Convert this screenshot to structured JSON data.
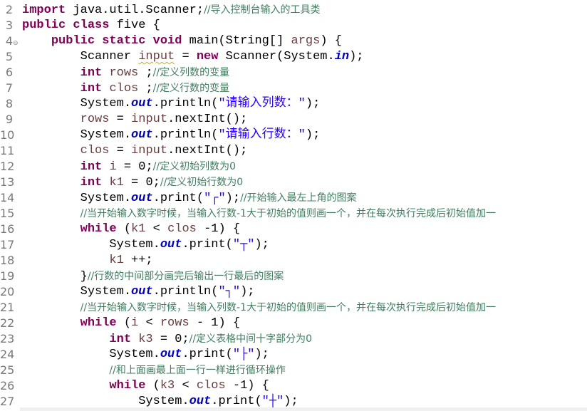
{
  "editor": {
    "language": "java",
    "lines": [
      {
        "n": "2",
        "tokens": [
          [
            "kw",
            "import"
          ],
          [
            "p",
            " java.util.Scanner;"
          ],
          [
            "cm",
            "//导入控制台输入的工具类"
          ]
        ]
      },
      {
        "n": "3",
        "tokens": [
          [
            "kw",
            "public"
          ],
          [
            "p",
            " "
          ],
          [
            "kw",
            "class"
          ],
          [
            "p",
            " five {"
          ]
        ]
      },
      {
        "n": "4",
        "fold": true,
        "tokens": [
          [
            "p",
            "    "
          ],
          [
            "kw",
            "public"
          ],
          [
            "p",
            " "
          ],
          [
            "kw",
            "static"
          ],
          [
            "p",
            " "
          ],
          [
            "kw",
            "void"
          ],
          [
            "p",
            " main(String[] "
          ],
          [
            "var",
            "args"
          ],
          [
            "p",
            ") {"
          ]
        ]
      },
      {
        "n": "5",
        "tokens": [
          [
            "p",
            "        Scanner "
          ],
          [
            "varsq",
            "input"
          ],
          [
            "p",
            " = "
          ],
          [
            "kw",
            "new"
          ],
          [
            "p",
            " Scanner(System."
          ],
          [
            "fld",
            "in"
          ],
          [
            "p",
            ");"
          ]
        ]
      },
      {
        "n": "6",
        "tokens": [
          [
            "p",
            "        "
          ],
          [
            "kw",
            "int"
          ],
          [
            "p",
            " "
          ],
          [
            "var",
            "rows"
          ],
          [
            "p",
            " ;"
          ],
          [
            "cm",
            "//定义列数的变量"
          ]
        ]
      },
      {
        "n": "7",
        "tokens": [
          [
            "p",
            "        "
          ],
          [
            "kw",
            "int"
          ],
          [
            "p",
            " "
          ],
          [
            "var",
            "clos"
          ],
          [
            "p",
            " ;"
          ],
          [
            "cm",
            "//定义行数的变量"
          ]
        ]
      },
      {
        "n": "8",
        "tokens": [
          [
            "p",
            "        System."
          ],
          [
            "fld",
            "out"
          ],
          [
            "p",
            ".println("
          ],
          [
            "str",
            "\"请输入列数：\""
          ],
          [
            "p",
            ");"
          ]
        ]
      },
      {
        "n": "9",
        "tokens": [
          [
            "p",
            "        "
          ],
          [
            "var",
            "rows"
          ],
          [
            "p",
            " = "
          ],
          [
            "var",
            "input"
          ],
          [
            "p",
            ".nextInt();"
          ]
        ]
      },
      {
        "n": "10",
        "tokens": [
          [
            "p",
            "        System."
          ],
          [
            "fld",
            "out"
          ],
          [
            "p",
            ".println("
          ],
          [
            "str",
            "\"请输入行数：\""
          ],
          [
            "p",
            ");"
          ]
        ]
      },
      {
        "n": "11",
        "tokens": [
          [
            "p",
            "        "
          ],
          [
            "var",
            "clos"
          ],
          [
            "p",
            " = "
          ],
          [
            "var",
            "input"
          ],
          [
            "p",
            ".nextInt();"
          ]
        ]
      },
      {
        "n": "12",
        "tokens": [
          [
            "p",
            "        "
          ],
          [
            "kw",
            "int"
          ],
          [
            "p",
            " "
          ],
          [
            "var",
            "i"
          ],
          [
            "p",
            " = 0;"
          ],
          [
            "cm",
            "//定义初始列数为0"
          ]
        ]
      },
      {
        "n": "13",
        "tokens": [
          [
            "p",
            "        "
          ],
          [
            "kw",
            "int"
          ],
          [
            "p",
            " "
          ],
          [
            "var",
            "k1"
          ],
          [
            "p",
            " = 0;"
          ],
          [
            "cm",
            "//定义初始行数为0"
          ]
        ]
      },
      {
        "n": "14",
        "tokens": [
          [
            "p",
            "        System."
          ],
          [
            "fld",
            "out"
          ],
          [
            "p",
            ".print("
          ],
          [
            "str",
            "\"┌\""
          ],
          [
            "p",
            ");"
          ],
          [
            "cm",
            "//开始输入最左上角的图案"
          ]
        ]
      },
      {
        "n": "15",
        "tokens": [
          [
            "p",
            "        "
          ],
          [
            "cm",
            "//当开始输入数字时候，当输入行数-1大于初始的值则画一个，并在每次执行完成后初始值加一"
          ]
        ]
      },
      {
        "n": "16",
        "tokens": [
          [
            "p",
            "        "
          ],
          [
            "kw",
            "while"
          ],
          [
            "p",
            " ("
          ],
          [
            "var",
            "k1"
          ],
          [
            "p",
            " < "
          ],
          [
            "var",
            "clos"
          ],
          [
            "p",
            " -1) {"
          ]
        ]
      },
      {
        "n": "17",
        "tokens": [
          [
            "p",
            "            System."
          ],
          [
            "fld",
            "out"
          ],
          [
            "p",
            ".print("
          ],
          [
            "str",
            "\"┬\""
          ],
          [
            "p",
            ");"
          ]
        ]
      },
      {
        "n": "18",
        "tokens": [
          [
            "p",
            "            "
          ],
          [
            "var",
            "k1"
          ],
          [
            "p",
            " ++;"
          ]
        ]
      },
      {
        "n": "19",
        "tokens": [
          [
            "p",
            "        }"
          ],
          [
            "cm",
            "//行数的中间部分画完后输出一行最后的图案"
          ]
        ]
      },
      {
        "n": "20",
        "tokens": [
          [
            "p",
            "        System."
          ],
          [
            "fld",
            "out"
          ],
          [
            "p",
            ".println("
          ],
          [
            "str",
            "\"┐\""
          ],
          [
            "p",
            ");"
          ]
        ]
      },
      {
        "n": "21",
        "tokens": [
          [
            "p",
            "        "
          ],
          [
            "cm",
            "//当开始输入数字时候，当输入列数-1大于初始的值则画一个，并在每次执行完成后初始值加一"
          ]
        ]
      },
      {
        "n": "22",
        "tokens": [
          [
            "p",
            "        "
          ],
          [
            "kw",
            "while"
          ],
          [
            "p",
            " ("
          ],
          [
            "var",
            "i"
          ],
          [
            "p",
            " < "
          ],
          [
            "var",
            "rows"
          ],
          [
            "p",
            " - 1) {"
          ]
        ]
      },
      {
        "n": "23",
        "tokens": [
          [
            "p",
            "            "
          ],
          [
            "kw",
            "int"
          ],
          [
            "p",
            " "
          ],
          [
            "var",
            "k3"
          ],
          [
            "p",
            " = 0;"
          ],
          [
            "cm",
            "//定义表格中间十字部分为0"
          ]
        ]
      },
      {
        "n": "24",
        "tokens": [
          [
            "p",
            "            System."
          ],
          [
            "fld",
            "out"
          ],
          [
            "p",
            ".print("
          ],
          [
            "str",
            "\"├\""
          ],
          [
            "p",
            ");"
          ]
        ]
      },
      {
        "n": "25",
        "tokens": [
          [
            "p",
            "            "
          ],
          [
            "cm",
            "//和上面画最上面一行一样进行循环操作"
          ]
        ]
      },
      {
        "n": "26",
        "tokens": [
          [
            "p",
            "            "
          ],
          [
            "kw",
            "while"
          ],
          [
            "p",
            " ("
          ],
          [
            "var",
            "k3"
          ],
          [
            "p",
            " < "
          ],
          [
            "var",
            "clos"
          ],
          [
            "p",
            " -1) {"
          ]
        ]
      },
      {
        "n": "27",
        "tokens": [
          [
            "p",
            "                System."
          ],
          [
            "fld",
            "out"
          ],
          [
            "p",
            ".print("
          ],
          [
            "str",
            "\"┼\""
          ],
          [
            "p",
            ");"
          ]
        ]
      }
    ]
  }
}
